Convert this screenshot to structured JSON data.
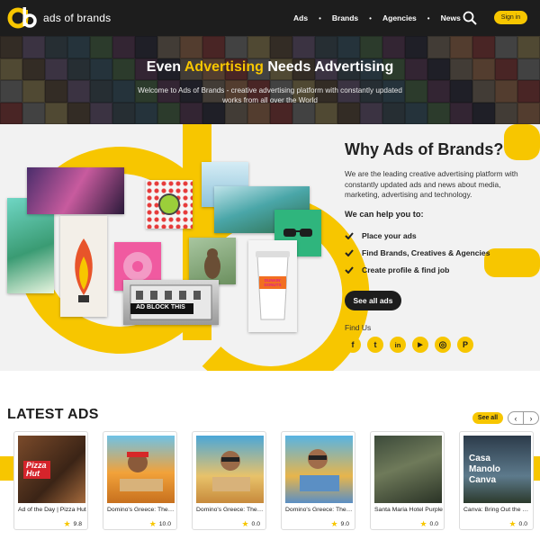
{
  "brand": {
    "name": "ads of brands",
    "logo_icon": "ab-logo-icon",
    "accent": "#f7c600",
    "dark": "#1d1d1d"
  },
  "nav": {
    "items": [
      "Ads",
      "Brands",
      "Agencies",
      "News"
    ],
    "search_icon": "search-icon",
    "signin_label": "Sign in"
  },
  "hero": {
    "title_pre": "Even ",
    "title_highlight": "Advertising",
    "title_post": " Needs Advertising",
    "subtitle": "Welcome to Ads of Brands - creative advertising platform with constantly updated works from all over the World"
  },
  "why": {
    "title": "Why Ads of Brands?",
    "description": "We are the leading creative advertising platform with constantly updated ads and news about media, marketing, advertising and technology.",
    "help_title": "We can help you to:",
    "bullets": [
      "Place your ads",
      "Find Brands, Creatives & Agencies",
      "Create profile & find job"
    ],
    "button_label": "See all ads",
    "find_us": "Find Us",
    "socials": [
      "facebook-icon",
      "twitter-icon",
      "linkedin-icon",
      "youtube-icon",
      "instagram-icon",
      "pinterest-icon"
    ],
    "social_glyphs": [
      "f",
      "t",
      "in",
      "▶",
      "◎",
      "P"
    ],
    "collage_texts": {
      "block": "AD BLOCK THIS",
      "dunkin": "DUNKIN' DONUTS"
    }
  },
  "latest": {
    "title": "LATEST ADS",
    "see_all": "See all",
    "prev_icon": "chevron-left-icon",
    "next_icon": "chevron-right-icon",
    "cards": [
      {
        "title": "Ad of the Day | Pizza Hut",
        "rating": "9.8",
        "thumb_label": "Pizza Hut"
      },
      {
        "title": "Domino's Greece: The Pizza",
        "rating": "10.0",
        "thumb_label": ""
      },
      {
        "title": "Domino's Greece: The Pizza",
        "rating": "0.0",
        "thumb_label": ""
      },
      {
        "title": "Domino's Greece: The Pizza",
        "rating": "9.0",
        "thumb_label": ""
      },
      {
        "title": "Santa Maria Hotel Purple",
        "rating": "0.0",
        "thumb_label": ""
      },
      {
        "title": "Canva: Bring Out the Best",
        "rating": "0.0",
        "thumb_label": "Casa Manolo Canva"
      }
    ]
  }
}
